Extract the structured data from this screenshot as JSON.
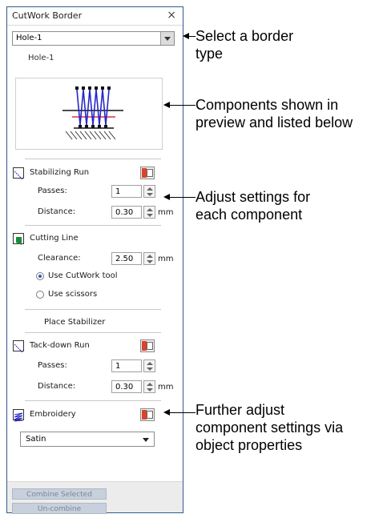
{
  "panel": {
    "title": "CutWork Border",
    "close_glyph": "×",
    "border_type": "Hole-1",
    "border_label": "Hole-1",
    "sections": {
      "stabilizing": {
        "title": "Stabilizing Run",
        "passes_label": "Passes:",
        "passes_value": "1",
        "distance_label": "Distance:",
        "distance_value": "0.30",
        "distance_unit": "mm"
      },
      "cutting": {
        "title": "Cutting Line",
        "clearance_label": "Clearance:",
        "clearance_value": "2.50",
        "clearance_unit": "mm",
        "option_cutwork": "Use CutWork tool",
        "option_scissors": "Use scissors",
        "selected_option": "cutwork"
      },
      "place_stabilizer": "Place Stabilizer",
      "tackdown": {
        "title": "Tack-down Run",
        "passes_label": "Passes:",
        "passes_value": "1",
        "distance_label": "Distance:",
        "distance_value": "0.30",
        "distance_unit": "mm"
      },
      "embroidery": {
        "title": "Embroidery",
        "stitch_type": "Satin"
      }
    },
    "buttons": {
      "combine": "Combine Selected",
      "uncombine": "Un-combine"
    }
  },
  "callouts": {
    "select": [
      "Select a border",
      "type"
    ],
    "components": [
      "Components shown in",
      "preview and listed below"
    ],
    "adjust": [
      "Adjust settings for",
      "each component"
    ],
    "further": [
      "Further adjust",
      "component settings via",
      "object properties"
    ]
  },
  "colors": {
    "panel_border": "#2f5b8d",
    "stitch_blue": "#2727c8",
    "cut_red": "#e0303a",
    "properties_red": "#d9442b",
    "radio_selected": "#2b5bb5"
  }
}
